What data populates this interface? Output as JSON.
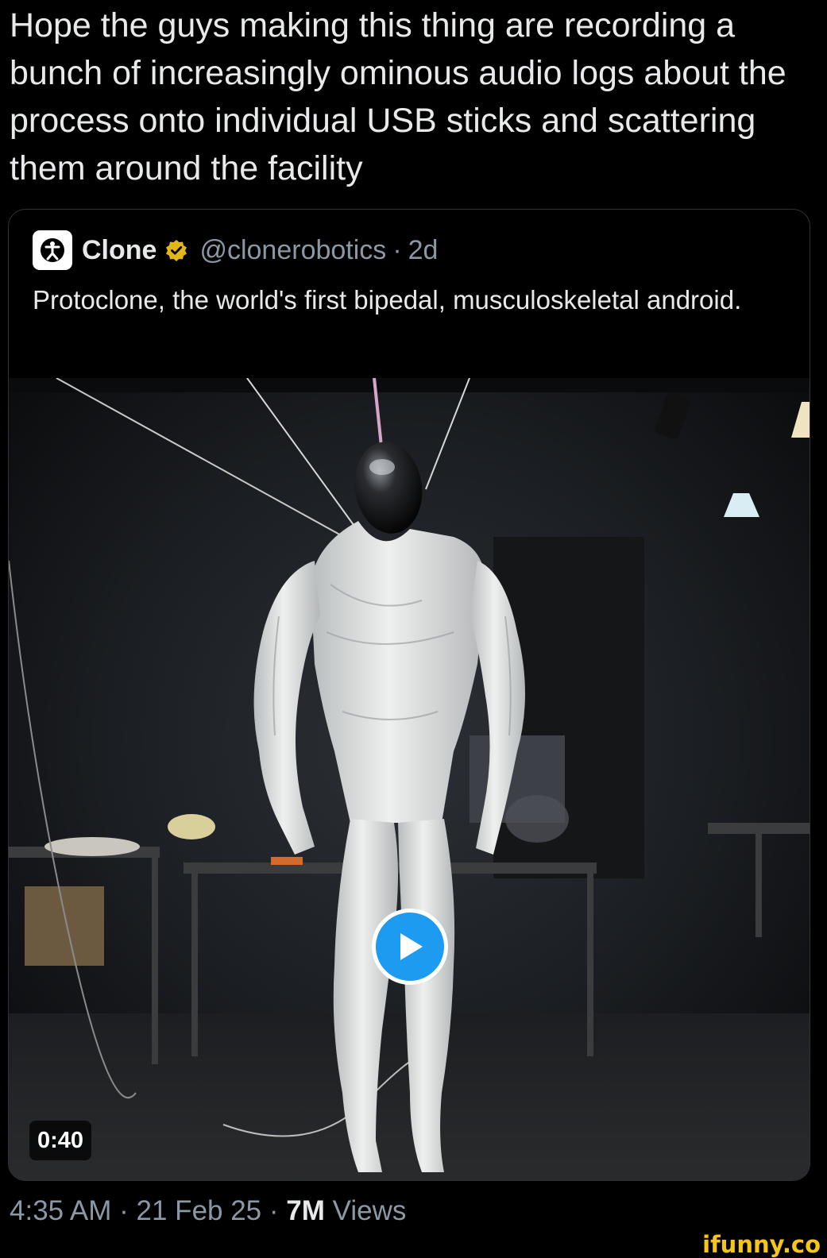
{
  "post": {
    "text": "Hope the guys making this thing are recording a bunch of increasingly ominous audio logs about the process onto individual USB sticks and scattering them around the facility"
  },
  "quoted": {
    "author_name": "Clone",
    "handle": "@clonerobotics",
    "separator": "·",
    "age": "2d",
    "text": "Protoclone, the world's first bipedal, musculoskeletal android.",
    "avatar_icon": "clone-logo-icon",
    "verified_icon": "gold-verified-badge-icon",
    "verified_color": "#e2b719"
  },
  "video": {
    "duration": "0:40",
    "play_icon": "play-icon",
    "play_color": "#1d9bf0"
  },
  "meta": {
    "time": "4:35 AM",
    "sep1": " · ",
    "date": "21 Feb 25",
    "sep2": " · ",
    "views_count": "7M",
    "views_label": " Views"
  },
  "watermark": {
    "text": "ifunny.co",
    "color": "#f5c518"
  }
}
